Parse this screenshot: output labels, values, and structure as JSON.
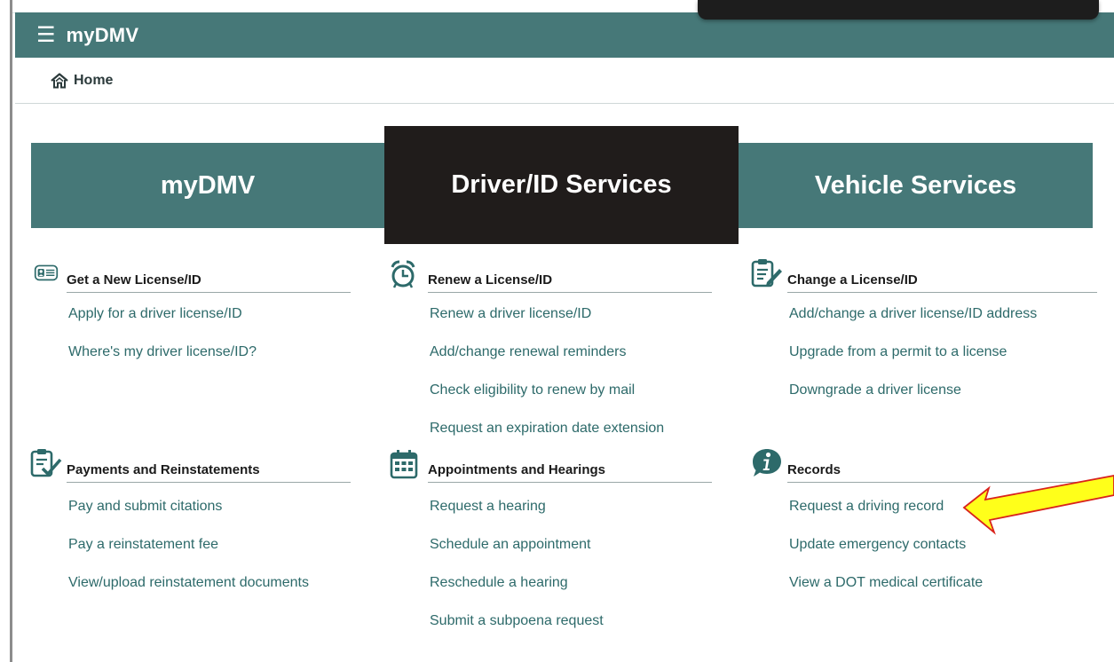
{
  "header": {
    "brand": "myDMV",
    "menu_icon": "hamburger-menu-icon"
  },
  "breadcrumb": {
    "home_label": "Home",
    "icon": "home-icon"
  },
  "tabs": [
    {
      "label": "myDMV",
      "active": false
    },
    {
      "label": "Driver/ID Services",
      "active": true
    },
    {
      "label": "Vehicle Services",
      "active": false
    }
  ],
  "sections": [
    {
      "title": "Get a New License/ID",
      "icon": "id-card-icon",
      "links": [
        "Apply for a driver license/ID",
        "Where's my driver license/ID?"
      ]
    },
    {
      "title": "Renew a License/ID",
      "icon": "alarm-clock-icon",
      "links": [
        "Renew a driver license/ID",
        "Add/change renewal reminders",
        "Check eligibility to renew by mail",
        "Request an expiration date extension"
      ]
    },
    {
      "title": "Change a License/ID",
      "icon": "edit-document-icon",
      "links": [
        "Add/change a driver license/ID address",
        "Upgrade from a permit to a license",
        "Downgrade a driver license"
      ]
    },
    {
      "title": "Payments and Reinstatements",
      "icon": "clipboard-check-icon",
      "links": [
        "Pay and submit citations",
        "Pay a reinstatement fee",
        "View/upload reinstatement documents"
      ]
    },
    {
      "title": "Appointments and Hearings",
      "icon": "calendar-icon",
      "links": [
        "Request a hearing",
        "Schedule an appointment",
        "Reschedule a hearing",
        "Submit a subpoena request"
      ]
    },
    {
      "title": "Records",
      "icon": "info-icon",
      "links": [
        "Request a driving record",
        "Update emergency contacts",
        "View a DOT medical certificate"
      ]
    }
  ],
  "colors": {
    "teal": "#467878",
    "dark_tab": "#201c1b",
    "link": "#2d6a6a",
    "arrow_fill": "#ffff1a",
    "arrow_stroke": "#d9231c"
  }
}
